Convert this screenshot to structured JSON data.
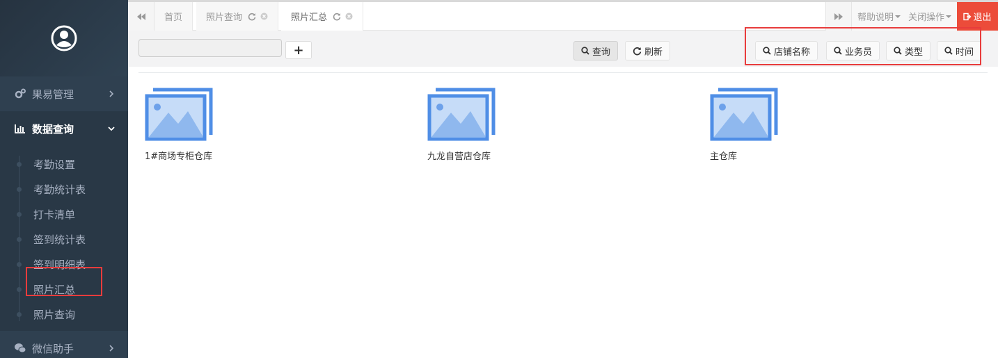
{
  "sidebar": {
    "menu": [
      {
        "label": "果易管理"
      },
      {
        "label": "数据查询"
      },
      {
        "label": "微信助手"
      }
    ],
    "submenu": [
      {
        "label": "考勤设置"
      },
      {
        "label": "考勤统计表"
      },
      {
        "label": "打卡清单"
      },
      {
        "label": "签到统计表"
      },
      {
        "label": "签到明细表"
      },
      {
        "label": "照片汇总"
      },
      {
        "label": "照片查询"
      }
    ]
  },
  "tabs": [
    {
      "label": "首页"
    },
    {
      "label": "照片查询"
    },
    {
      "label": "照片汇总"
    }
  ],
  "topbar": {
    "help": "帮助说明",
    "close_ops": "关闭操作",
    "logout": "退出"
  },
  "toolbar": {
    "search_value": "",
    "plus": "+",
    "query": "查询",
    "refresh": "刷新",
    "filters": [
      "店铺名称",
      "业务员",
      "类型",
      "时间"
    ]
  },
  "cards": [
    {
      "label": "1#商场专柜仓库"
    },
    {
      "label": "九龙自营店仓库"
    },
    {
      "label": "主仓库"
    }
  ],
  "colors": {
    "sidebar_bg": "#2f4050",
    "accent_blue": "#5a93e6",
    "logout_red": "#ec4c3a",
    "highlight_red": "#e83c3c"
  }
}
